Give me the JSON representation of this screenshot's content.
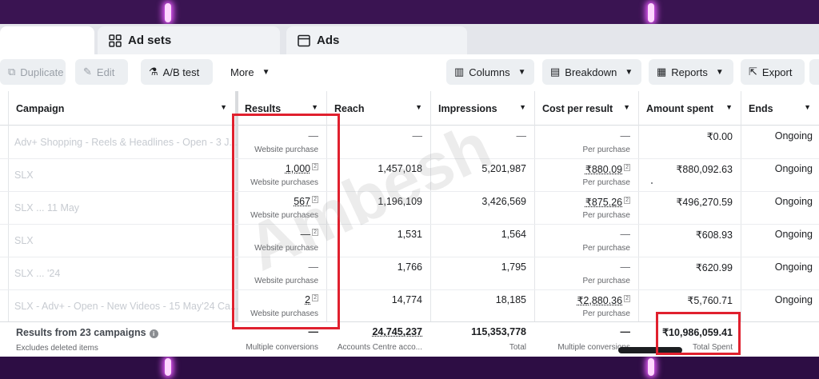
{
  "tabs": {
    "adsets_label": "Ad sets",
    "ads_label": "Ads"
  },
  "toolbar": {
    "duplicate": "Duplicate",
    "edit": "Edit",
    "ab_test": "A/B test",
    "more": "More",
    "columns": "Columns",
    "breakdown": "Breakdown",
    "reports": "Reports",
    "export": "Export"
  },
  "columns": {
    "campaign": "Campaign",
    "results": "Results",
    "reach": "Reach",
    "impressions": "Impressions",
    "cost_per_result": "Cost per result",
    "amount_spent": "Amount spent",
    "ends": "Ends"
  },
  "rows": [
    {
      "campaign": "Adv+ Shopping - Reels & Headlines - Open - 3 J...",
      "results": "—",
      "results_sub": "Website purchase",
      "reach": "—",
      "impressions": "—",
      "cpr": "—",
      "cpr_sub": "Per purchase",
      "spent": "₹0.00",
      "ends": "Ongoing"
    },
    {
      "campaign": "SLX",
      "results": "1,000",
      "results_sub": "Website purchases",
      "reach": "1,457,018",
      "impressions": "5,201,987",
      "cpr": "₹880.09",
      "cpr_sub": "Per purchase",
      "spent": "₹880,092.63",
      "ends": "Ongoing"
    },
    {
      "campaign": "SLX ... 11 May",
      "results": "567",
      "results_sub": "Website purchases",
      "reach": "1,196,109",
      "impressions": "3,426,569",
      "cpr": "₹875.26",
      "cpr_sub": "Per purchase",
      "spent": "₹496,270.59",
      "ends": "Ongoing"
    },
    {
      "campaign": "SLX",
      "results": "—",
      "results_sub": "Website purchase",
      "reach": "1,531",
      "impressions": "1,564",
      "cpr": "—",
      "cpr_sub": "Per purchase",
      "spent": "₹608.93",
      "ends": "Ongoing"
    },
    {
      "campaign": "SLX ... '24",
      "results": "—",
      "results_sub": "Website purchase",
      "reach": "1,766",
      "impressions": "1,795",
      "cpr": "—",
      "cpr_sub": "Per purchase",
      "spent": "₹620.99",
      "ends": "Ongoing"
    },
    {
      "campaign": "SLX - Adv+ - Open - New Videos - 15 May'24 Ca...",
      "results": "2",
      "results_sub": "Website purchases",
      "reach": "14,774",
      "impressions": "18,185",
      "cpr": "₹2,880.36",
      "cpr_sub": "Per purchase",
      "spent": "₹5,760.71",
      "ends": "Ongoing"
    }
  ],
  "footer": {
    "title": "Results from 23 campaigns",
    "subtitle": "Excludes deleted items",
    "results": "—",
    "results_sub": "Multiple conversions",
    "reach": "24,745,237",
    "reach_sub": "Accounts Centre acco...",
    "impressions": "115,353,778",
    "impressions_sub": "Total",
    "cpr": "—",
    "cpr_sub": "Multiple conversions",
    "spent": "₹10,986,059.41",
    "spent_sub": "Total Spent"
  },
  "watermark": "Ambesh",
  "colors": {
    "highlight": "#e0202e",
    "background": "#3a1452",
    "neon": "#e95cff"
  }
}
